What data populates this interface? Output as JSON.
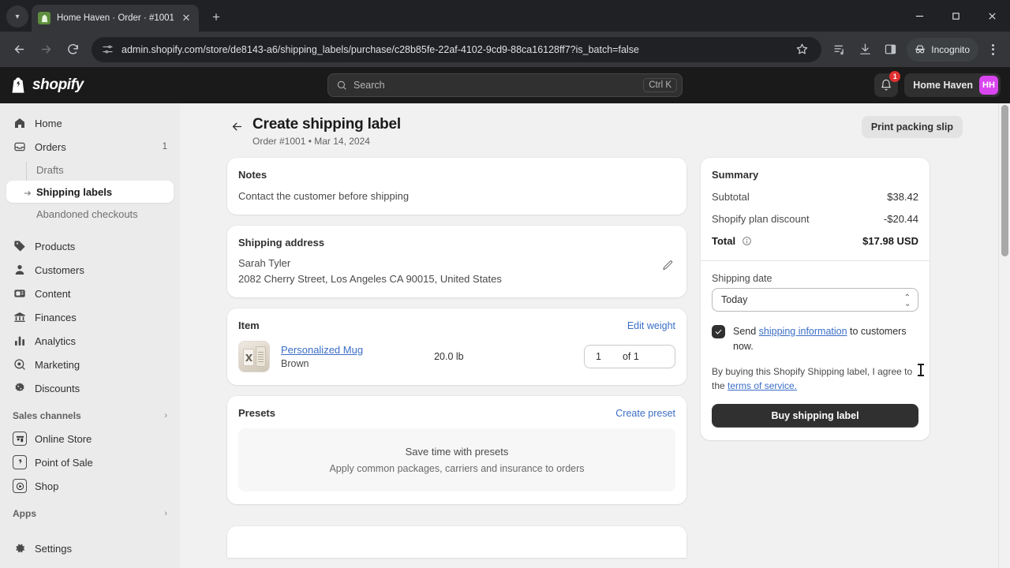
{
  "browser": {
    "tab": {
      "title": "Home Haven · Order · #1001 - ",
      "favicon": "shopify-bag-icon",
      "close": "✕"
    },
    "newtab_label": "+",
    "window_controls": {
      "minimize": "—",
      "maximize": "❐",
      "close": "✕"
    },
    "nav": {
      "back": "back-arrow-icon",
      "forward": "forward-arrow-icon",
      "reload": "reload-icon"
    },
    "url": "admin.shopify.com/store/de8143-a6/shipping_labels/purchase/c28b85fe-22af-4102-9cd9-88ca16128ff7?is_batch=false",
    "url_prefix": "admin.shopify.com",
    "toolbar_icons": [
      "star-icon",
      "reading-list-icon",
      "download-icon",
      "side-panel-icon"
    ],
    "incognito_label": "Incognito",
    "menu": "kebab-menu-icon"
  },
  "topbar": {
    "brand": "shopify",
    "search_placeholder": "Search",
    "search_shortcut": "Ctrl K",
    "notification_count": "1",
    "store_name": "Home Haven",
    "avatar_initials": "HH"
  },
  "sidebar": {
    "items": [
      {
        "label": "Home",
        "icon": "home-icon",
        "count": ""
      },
      {
        "label": "Orders",
        "icon": "orders-inbox-icon",
        "count": "1"
      }
    ],
    "suborders": [
      {
        "label": "Drafts",
        "active": false
      },
      {
        "label": "Shipping labels",
        "active": true
      },
      {
        "label": "Abandoned checkouts",
        "active": false
      }
    ],
    "items2": [
      {
        "label": "Products",
        "icon": "tag-icon"
      },
      {
        "label": "Customers",
        "icon": "person-icon"
      },
      {
        "label": "Content",
        "icon": "content-icon"
      },
      {
        "label": "Finances",
        "icon": "bank-icon"
      },
      {
        "label": "Analytics",
        "icon": "bar-chart-icon"
      },
      {
        "label": "Marketing",
        "icon": "megaphone-target-icon"
      },
      {
        "label": "Discounts",
        "icon": "discount-badge-icon"
      }
    ],
    "sales_channels_header": "Sales channels",
    "channels": [
      {
        "label": "Online Store",
        "icon": "storefront-icon"
      },
      {
        "label": "Point of Sale",
        "icon": "pos-icon"
      },
      {
        "label": "Shop",
        "icon": "shop-icon"
      }
    ],
    "apps_header": "Apps",
    "settings": {
      "label": "Settings",
      "icon": "gear-icon"
    }
  },
  "page": {
    "title": "Create shipping label",
    "subtitle": "Order #1001 • Mar 14, 2024",
    "back_icon": "back-arrow-icon",
    "print_button": "Print packing slip"
  },
  "notes": {
    "title": "Notes",
    "body": "Contact the customer before shipping"
  },
  "shipping_address": {
    "title": "Shipping address",
    "name": "Sarah Tyler",
    "address": "2082 Cherry Street, Los Angeles CA 90015, United States",
    "edit_icon": "pencil-icon"
  },
  "item": {
    "title": "Item",
    "edit_weight_link": "Edit weight",
    "product_name": "Personalized Mug",
    "variant": "Brown",
    "weight": "20.0 lb",
    "quantity": "1",
    "quantity_of": "of 1"
  },
  "presets": {
    "title": "Presets",
    "create_link": "Create preset",
    "empty_title": "Save time with presets",
    "empty_subtitle": "Apply common packages, carriers and insurance to orders"
  },
  "summary": {
    "title": "Summary",
    "rows": [
      {
        "label": "Subtotal",
        "value": "$38.42"
      },
      {
        "label": "Shopify plan discount",
        "value": "-$20.44"
      }
    ],
    "total_label": "Total",
    "total_value": "$17.98 USD",
    "total_info_icon": "info-icon",
    "shipping_date_label": "Shipping date",
    "shipping_date_value": "Today",
    "send_info_prefix": "Send ",
    "send_info_link": "shipping information",
    "send_info_suffix": " to customers now.",
    "terms_prefix": "By buying this Shopify Shipping label, I agree to the ",
    "terms_link": "terms of service.",
    "buy_button": "Buy shipping label"
  },
  "colors": {
    "accent_link": "#3b6ec6",
    "avatar": "#d946ef",
    "badge": "#e03030",
    "dark_button": "#303030"
  }
}
